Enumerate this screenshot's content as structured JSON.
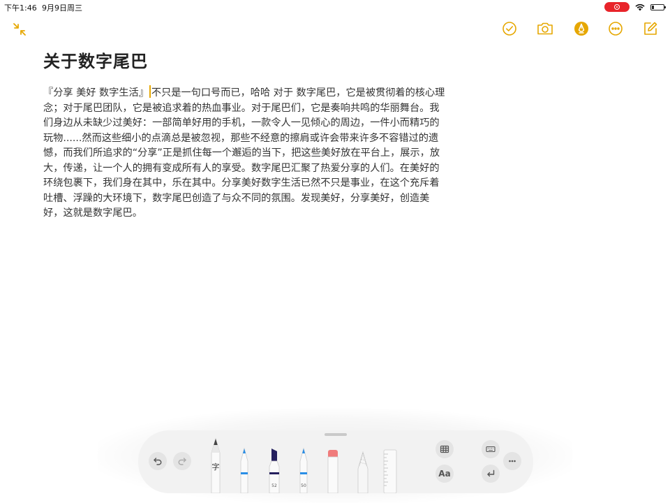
{
  "status_bar": {
    "time": "下午1:46",
    "date": "9月9日周三",
    "recording_icon": "screen-record-icon",
    "wifi_icon": "wifi-icon",
    "battery_icon": "battery-icon"
  },
  "top_bar": {
    "left_icon": "collapse-icon",
    "right_icons": [
      "checklist-icon",
      "camera-icon",
      "markup-icon",
      "more-icon",
      "compose-icon"
    ]
  },
  "note": {
    "title": "关于数字尾巴",
    "body_before_cursor": "『分享 美好 数字生活』",
    "body_after_cursor": "不只是一句口号而已，哈哈 对于 数字尾巴，它是被贯彻着的核心理念；对于尾巴团队，它是被追求着的热血事业。对于尾巴们，它是奏响共鸣的华丽舞台。我们身边从未缺少过美好：一部简单好用的手机，一款令人一见倾心的周边，一件小而精巧的玩物......然而这些细小的点滴总是被忽视，那些不经意的擦肩或许会带来许多不容错过的遗憾，而我们所追求的“分享”正是抓住每一个邂逅的当下，把这些美好放在平台上，展示，放大，传递，让一个人的拥有变成所有人的享受。数字尾巴汇聚了热爱分享的人们。在美好的环绕包裹下，我们身在其中，乐在其中。分享美好数字生活已然不只是事业，在这个充斥着吐槽、浮躁的大环境下，数字尾巴创造了与众不同的氛围。发现美好，分享美好，创造美好，这就是数字尾巴。"
  },
  "drawing_toolbar": {
    "undo_icon": "undo-icon",
    "redo_icon": "redo-icon",
    "tools": [
      {
        "name": "handwriting-pencil",
        "label": "字"
      },
      {
        "name": "pen",
        "color": "#2a8ee6"
      },
      {
        "name": "marker",
        "color": "#25205e",
        "label": "52"
      },
      {
        "name": "pencil",
        "color": "#2a8ee6",
        "label": "50"
      },
      {
        "name": "eraser",
        "color": "#f07b7b"
      },
      {
        "name": "lasso"
      },
      {
        "name": "ruler"
      }
    ],
    "table_icon": "table-icon",
    "format_label": "Aa",
    "keyboard_icon": "keyboard-icon",
    "return_icon": "return-icon",
    "more_icon": "more-icon"
  },
  "colors": {
    "accent": "#e6a700",
    "record": "#e8242a"
  }
}
